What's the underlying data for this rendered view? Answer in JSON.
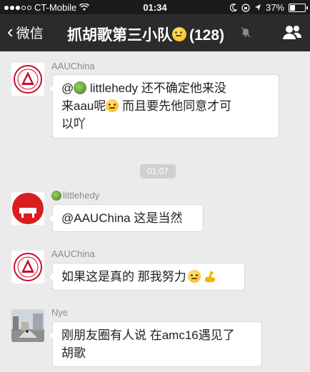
{
  "status_bar": {
    "carrier": "CT-Mobile",
    "time": "01:34",
    "battery_text": "37%",
    "battery_level": 0.37,
    "signal_icon": "signal-dots-icon",
    "wifi_icon": "wifi-icon"
  },
  "nav": {
    "back_label": "微信",
    "title": "抓胡歌第三小队",
    "member_count": "(128)",
    "title_emoji_icon": "flushed-face-icon",
    "mute_icon": "mute-icon",
    "group_icon": "people-icon"
  },
  "messages": [
    {
      "sender": "AAUChina",
      "avatar_icon": "aau-logo-icon",
      "line1_pre": "@",
      "line1_mention": "littlehedy",
      "line1_post": " 还不确定他来没",
      "line2_pre": "来aau呢",
      "line2_post": " 而且要先他同意才可",
      "line3": "以吖"
    },
    {
      "sender": "littlehedy",
      "avatar_icon": "red-avatar-icon",
      "text": "@AAUChina 这是当然"
    },
    {
      "sender": "AAUChina",
      "avatar_icon": "aau-logo-icon",
      "text": "如果这是真的 那我努力"
    },
    {
      "sender": "Nye",
      "avatar_icon": "street-photo-avatar-icon",
      "line1": "刚朋友圈有人说 在amc16遇见了",
      "line2": "胡歌"
    }
  ],
  "time_divider": "01:07",
  "colors": {
    "nav_bg": "#2b2b2d",
    "status_bg": "#1b1b1d",
    "chat_bg": "#ebebeb",
    "bubble_bg": "#ffffff",
    "aau_red": "#c8102e"
  }
}
